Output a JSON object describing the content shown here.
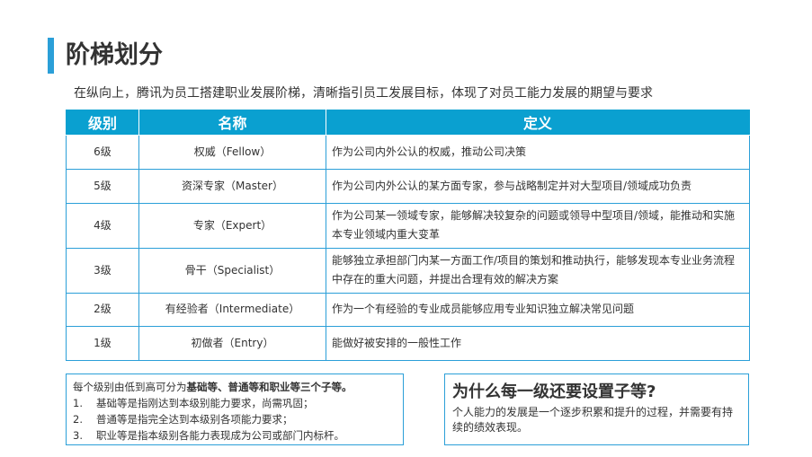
{
  "header": {
    "title": "阶梯划分",
    "subtitle": "在纵向上，腾讯为员工搭建职业发展阶梯，清晰指引员工发展目标，体现了对员工能力发展的期望与要求"
  },
  "table": {
    "columns": [
      "级别",
      "名称",
      "定义"
    ],
    "rows": [
      {
        "level": "6级",
        "name": "权威（Fellow）",
        "definition": "作为公司内外公认的权威，推动公司决策"
      },
      {
        "level": "5级",
        "name": "资深专家（Master）",
        "definition": "作为公司内外公认的某方面专家，参与战略制定并对大型项目/领域成功负责"
      },
      {
        "level": "4级",
        "name": "专家（Expert）",
        "definition": "作为公司某一领域专家，能够解决较复杂的问题或领导中型项目/领域，能推动和实施本专业领域内重大变革"
      },
      {
        "level": "3级",
        "name": "骨干（Specialist）",
        "definition": "能够独立承担部门内某一方面工作/项目的策划和推动执行，能够发现本专业业务流程中存在的重大问题，并提出合理有效的解决方案"
      },
      {
        "level": "2级",
        "name": "有经验者（Intermediate）",
        "definition": "作为一个有经验的专业成员能够应用专业知识独立解决常见问题"
      },
      {
        "level": "1级",
        "name": "初做者（Entry）",
        "definition": "能做好被安排的一般性工作"
      }
    ]
  },
  "notes": {
    "intro_plain": "每个级别由低到高可分为",
    "intro_bold": "基础等、普通等和职业等三个子等。",
    "items": [
      {
        "num": "1.",
        "text": "基础等是指刚达到本级别能力要求，尚需巩固；"
      },
      {
        "num": "2.",
        "text": "普通等是指完全达到本级别各项能力要求；"
      },
      {
        "num": "3.",
        "text": "职业等是指本级别各能力表现成为公司或部门内标杆。"
      }
    ]
  },
  "why": {
    "question": "为什么每一级还要设置子等?",
    "answer": "个人能力的发展是一个逐步积累和提升的过程，并需要有持续的绩效表现。"
  },
  "colors": {
    "accent": "#2b9fd8",
    "header_fill": "#0aa0d0",
    "text": "#333333"
  }
}
